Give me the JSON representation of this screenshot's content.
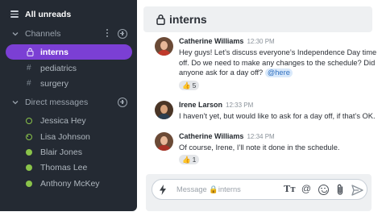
{
  "sidebar": {
    "all_unreads": "All unreads",
    "channels_label": "Channels",
    "channels": [
      {
        "label": "interns",
        "icon": "lock-icon",
        "selected": true
      },
      {
        "label": "pediatrics",
        "icon": "hash-icon",
        "selected": false
      },
      {
        "label": "surgery",
        "icon": "hash-icon",
        "selected": false
      }
    ],
    "hash_glyph": "#",
    "dm_label": "Direct messages",
    "direct_messages": [
      {
        "label": "Jessica Hey",
        "status": "away"
      },
      {
        "label": "Lisa Johnson",
        "status": "dnd"
      },
      {
        "label": "Blair Jones",
        "status": "online"
      },
      {
        "label": "Thomas Lee",
        "status": "online"
      },
      {
        "label": "Anthony McKey",
        "status": "online"
      }
    ]
  },
  "channel": {
    "title": "interns"
  },
  "messages": [
    {
      "author": "Catherine Williams",
      "time": "12:30 PM",
      "text": "Hey guys! Let’s discuss everyone’s Independence Day time off. Do we need to make any changes to the schedule? Did anyone ask for a day off?",
      "mention": "@here",
      "reaction": {
        "emoji": "👍",
        "count": "5"
      }
    },
    {
      "author": "Irene Larson",
      "time": "12:33 PM",
      "text": "I haven’t yet, but would like to ask for a day off, if that’s OK."
    },
    {
      "author": "Catherine Williams",
      "time": "12:34 PM",
      "text": "Of course, Irene, I’ll note it done in the schedule.",
      "reaction": {
        "emoji": "👍",
        "count": "1"
      }
    }
  ],
  "composer": {
    "placeholder": "Message 🔒interns",
    "text_format_label": "Tт",
    "mention_label": "@"
  },
  "colors": {
    "sidebar_bg": "#242a33",
    "accent": "#7b3fd4",
    "status_green": "#8ac34a",
    "mention_bg": "#d9e9fb"
  }
}
